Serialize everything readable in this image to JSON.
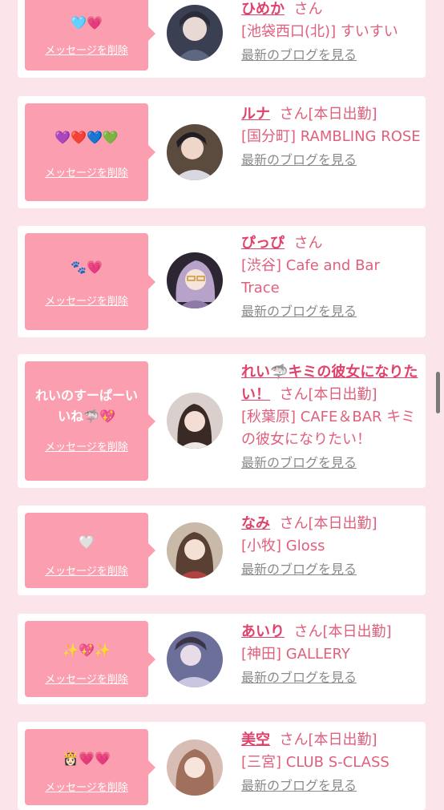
{
  "common": {
    "delete_label": "メッセージを削除",
    "blog_label": "最新のブログを見る",
    "san_suffix": "さん",
    "on_duty": "[本日出勤]"
  },
  "items": [
    {
      "message": "🩵💗",
      "name": "ひめか",
      "on_duty": false,
      "shop": "[池袋西口(北)] すいすい"
    },
    {
      "message": "💜❤️💙💚",
      "name": "ルナ",
      "on_duty": true,
      "shop": "[国分町] RAMBLING ROSE"
    },
    {
      "message": "🐾💗",
      "name": "ぴっぴ",
      "on_duty": false,
      "shop": "[渋谷] Cafe and Bar Trace"
    },
    {
      "message": "れいのすーぱーいいね🦈💖",
      "name": "れい🦈キミの彼女になりたい！",
      "on_duty": true,
      "shop": "[秋葉原] CAFE＆BAR キミの彼女になりたい！"
    },
    {
      "message": "🤍",
      "name": "なみ",
      "on_duty": true,
      "shop": "[小牧] Gloss"
    },
    {
      "message": "✨💖✨",
      "name": "あいり",
      "on_duty": true,
      "shop": "[神田] GALLERY"
    },
    {
      "message": "👸🏻💗💗",
      "name": "美空",
      "on_duty": true,
      "shop": "[三宮] CLUB S-CLASS"
    }
  ],
  "colors": {
    "background": "#fbe4ea",
    "bubble": "#fb9fb0",
    "name": "#e0426b",
    "text": "#e05f7b",
    "blog_link": "#8a8a8a"
  }
}
